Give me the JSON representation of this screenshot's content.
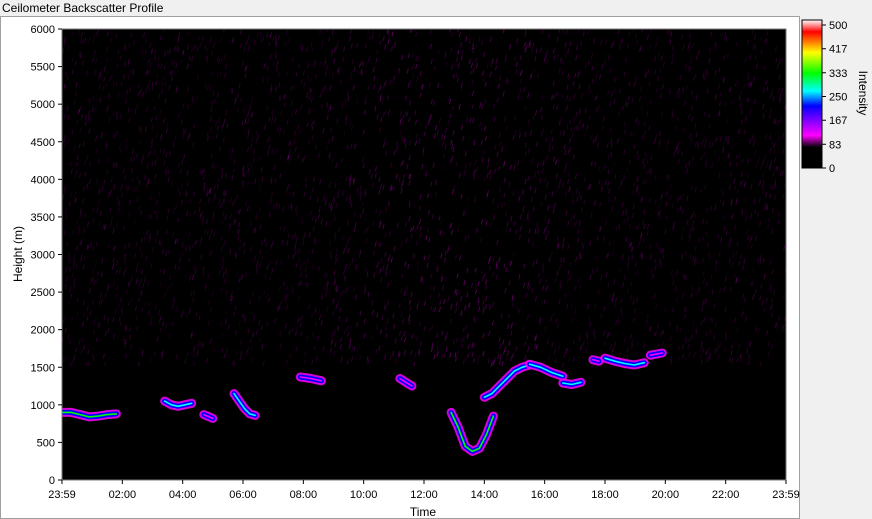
{
  "window": {
    "title": "Ceilometer Backscatter Profile"
  },
  "colors": {
    "background": "#000000",
    "noise": "#b000b0",
    "scale": [
      "#000000",
      "#ff00ff",
      "#0000ff",
      "#00ffff",
      "#00ff00",
      "#ffff00",
      "#ff0000",
      "#ffffff"
    ]
  },
  "chart_data": {
    "type": "heatmap",
    "title": "",
    "xlabel": "Time",
    "ylabel": "Height (m)",
    "colorbar_label": "Intensity",
    "x_ticks": [
      "23:59",
      "02:00",
      "04:00",
      "06:00",
      "08:00",
      "10:00",
      "12:00",
      "14:00",
      "16:00",
      "18:00",
      "20:00",
      "22:00",
      "23:59"
    ],
    "y_ticks": [
      "0",
      "500",
      "1000",
      "1500",
      "2000",
      "2500",
      "3000",
      "3500",
      "4000",
      "4500",
      "5000",
      "5500",
      "6000"
    ],
    "ylim": [
      0,
      6000
    ],
    "xlim_hours": [
      0,
      24
    ],
    "colorbar_ticks": [
      "500",
      "417",
      "333",
      "250",
      "167",
      "83",
      "0"
    ],
    "colorbar_range": [
      0,
      500
    ],
    "layers": [
      {
        "t_start": 0.0,
        "t_end": 1.8,
        "heights": [
          900,
          900,
          870,
          840,
          850,
          870,
          880
        ],
        "peak_intensity": 260
      },
      {
        "t_start": 3.4,
        "t_end": 4.3,
        "heights": [
          1050,
          1000,
          980,
          1000,
          1020
        ],
        "peak_intensity": 220
      },
      {
        "t_start": 4.7,
        "t_end": 5.0,
        "heights": [
          870,
          820
        ],
        "peak_intensity": 180
      },
      {
        "t_start": 5.7,
        "t_end": 6.4,
        "heights": [
          1150,
          1050,
          950,
          880,
          860
        ],
        "peak_intensity": 210
      },
      {
        "t_start": 7.9,
        "t_end": 8.6,
        "heights": [
          1370,
          1350,
          1320
        ],
        "peak_intensity": 120
      },
      {
        "t_start": 11.2,
        "t_end": 11.6,
        "heights": [
          1350,
          1300,
          1250
        ],
        "peak_intensity": 140
      },
      {
        "t_start": 12.9,
        "t_end": 14.3,
        "heights": [
          900,
          700,
          450,
          380,
          420,
          600,
          850
        ],
        "peak_intensity": 300
      },
      {
        "t_start": 14.0,
        "t_end": 15.5,
        "heights": [
          1100,
          1150,
          1250,
          1350,
          1450,
          1500,
          1530
        ],
        "peak_intensity": 190
      },
      {
        "t_start": 15.5,
        "t_end": 16.6,
        "heights": [
          1540,
          1500,
          1430,
          1380
        ],
        "peak_intensity": 200
      },
      {
        "t_start": 16.6,
        "t_end": 17.2,
        "heights": [
          1290,
          1270,
          1300
        ],
        "peak_intensity": 190
      },
      {
        "t_start": 17.6,
        "t_end": 17.8,
        "heights": [
          1600,
          1580
        ],
        "peak_intensity": 160
      },
      {
        "t_start": 18.0,
        "t_end": 19.3,
        "heights": [
          1620,
          1580,
          1550,
          1530,
          1560
        ],
        "peak_intensity": 220
      },
      {
        "t_start": 19.5,
        "t_end": 19.9,
        "heights": [
          1660,
          1690
        ],
        "peak_intensity": 160
      }
    ]
  }
}
